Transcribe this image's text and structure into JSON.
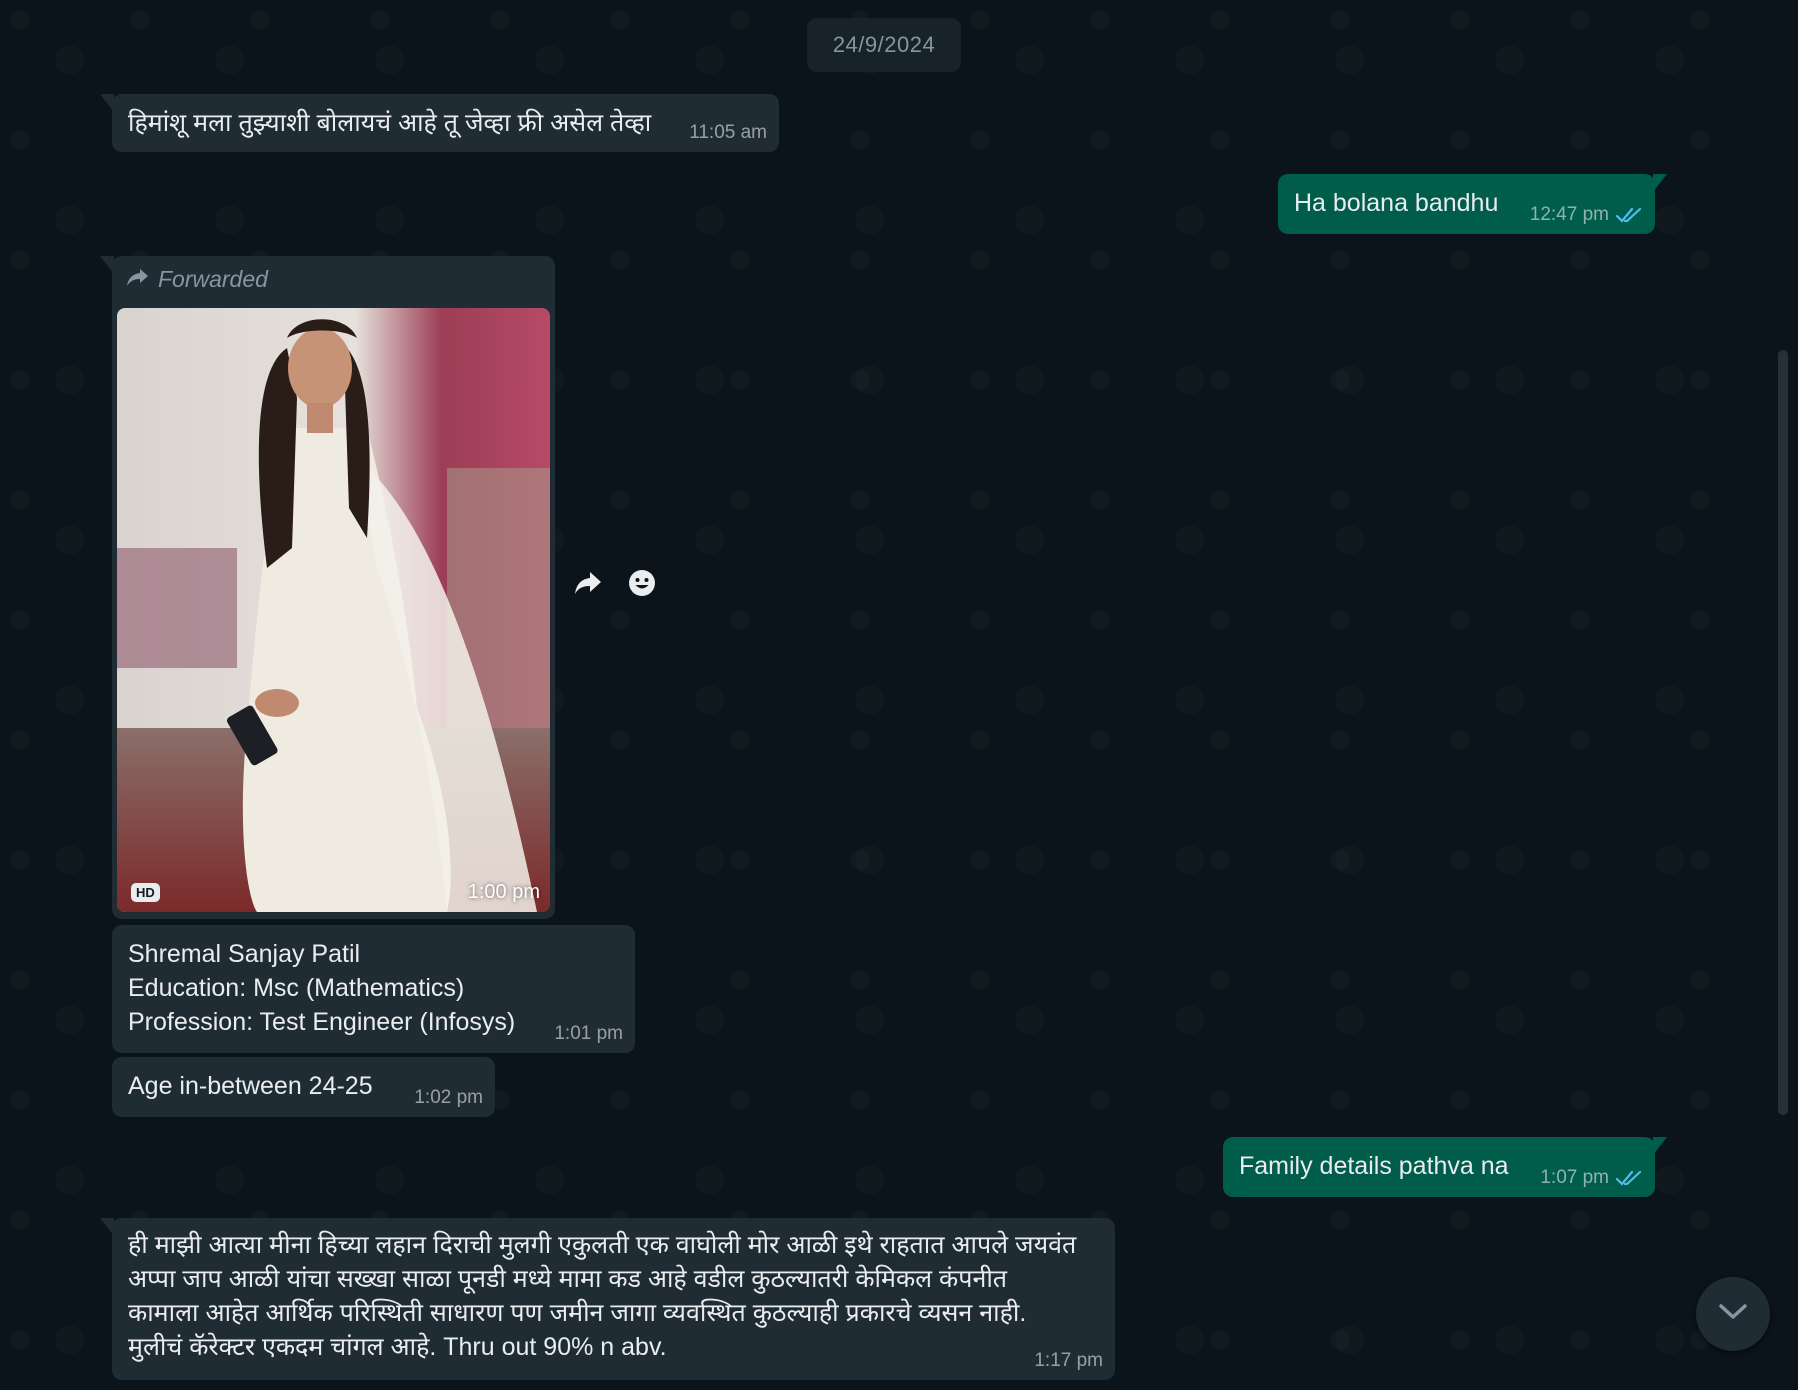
{
  "date_label": "24/9/2024",
  "messages": [
    {
      "text": "हिमांशू मला तुझ्याशी बोलायचं आहे तू जेव्हा फ्री असेल तेव्हा",
      "time": "11:05 am",
      "direction": "in"
    },
    {
      "text": "Ha bolana bandhu",
      "time": "12:47 pm",
      "direction": "out",
      "status": "read"
    },
    {
      "forwarded_label": "Forwarded",
      "media": "photo",
      "hd_badge": "HD",
      "time": "1:00 pm",
      "direction": "in"
    },
    {
      "lines": [
        "Shremal Sanjay Patil",
        "Education: Msc (Mathematics)",
        "Profession: Test Engineer (Infosys)"
      ],
      "time": "1:01 pm",
      "direction": "in"
    },
    {
      "text": "Age in-between 24-25",
      "time": "1:02 pm",
      "direction": "in"
    },
    {
      "text": "Family details pathva na",
      "time": "1:07 pm",
      "direction": "out",
      "status": "read"
    },
    {
      "lines": [
        "ही माझी आत्या मीना हिच्या लहान दिराची मुलगी एकुलती एक वाघोली मोर आळी इथे राहतात आपले जयवंत",
        "अप्पा जाप आळी यांचा सख्खा साळा पूनडी मध्ये  मामा कड आहे वडील कुठल्यातरी केमिकल कंपनीत",
        "कामाला आहेत आर्थिक परिस्थिती साधारण पण जमीन जागा व्यवस्थित कुठल्याही प्रकारचे व्यसन नाही.",
        "मुलीचं कॅरेक्टर एकदम चांगल आहे. Thru out 90% n abv."
      ],
      "time": "1:17 pm",
      "direction": "in"
    }
  ],
  "icons": {
    "forward": "forward-arrow-icon",
    "react": "emoji-icon",
    "read": "double-check-icon",
    "scroll": "chevron-down-icon"
  },
  "colors": {
    "background": "#0b141a",
    "incoming": "#202c33",
    "outgoing": "#005c4b",
    "read_tick": "#53bdeb"
  }
}
